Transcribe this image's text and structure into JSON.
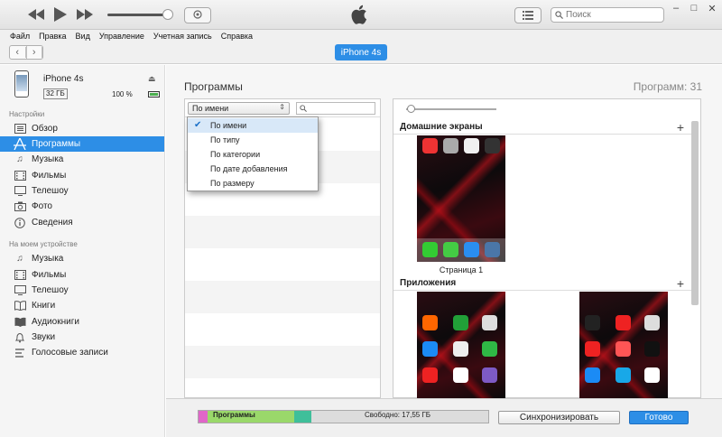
{
  "toolbar": {
    "search_placeholder": "Поиск"
  },
  "menu": [
    "Файл",
    "Правка",
    "Вид",
    "Управление",
    "Учетная запись",
    "Справка"
  ],
  "device_pill": "iPhone 4s",
  "device": {
    "name": "iPhone 4s",
    "capacity": "32 ГБ",
    "battery": "100 %"
  },
  "sidebar": {
    "settings_title": "Настройки",
    "settings_items": [
      {
        "label": "Обзор",
        "icon": "overview-icon"
      },
      {
        "label": "Программы",
        "icon": "apps-icon",
        "active": true
      },
      {
        "label": "Музыка",
        "icon": "music-icon"
      },
      {
        "label": "Фильмы",
        "icon": "film-icon"
      },
      {
        "label": "Телешоу",
        "icon": "tv-icon"
      },
      {
        "label": "Фото",
        "icon": "camera-icon"
      },
      {
        "label": "Сведения",
        "icon": "info-icon"
      }
    ],
    "device_title": "На моем устройстве",
    "device_items": [
      {
        "label": "Музыка",
        "icon": "music-icon"
      },
      {
        "label": "Фильмы",
        "icon": "film-icon"
      },
      {
        "label": "Телешоу",
        "icon": "tv-icon"
      },
      {
        "label": "Книги",
        "icon": "book-icon"
      },
      {
        "label": "Аудиокниги",
        "icon": "audiobook-icon"
      },
      {
        "label": "Звуки",
        "icon": "bell-icon"
      },
      {
        "label": "Голосовые записи",
        "icon": "voice-memo-icon"
      }
    ]
  },
  "main": {
    "title": "Программы",
    "count": "Программ: 31",
    "sort_selected": "По имени",
    "sort_options": [
      "По имени",
      "По типу",
      "По категории",
      "По дате добавления",
      "По размеру"
    ],
    "home_screens_title": "Домашние экраны",
    "page1_caption": "Страница 1",
    "apps_title": "Приложения"
  },
  "storage": {
    "programs_label": "Программы",
    "free_label": "Свободно: 17,55 ГБ",
    "segments": [
      {
        "color": "#e066c8",
        "fraction": 0.03
      },
      {
        "color": "#9ad86a",
        "fraction": 0.3
      },
      {
        "color": "#3fbf9a",
        "fraction": 0.06
      },
      {
        "color": "#dcdcdc",
        "fraction": 0.61
      }
    ]
  },
  "buttons": {
    "sync": "Синхронизировать",
    "done": "Готово"
  },
  "colors": {
    "accent": "#2d8ee6"
  }
}
